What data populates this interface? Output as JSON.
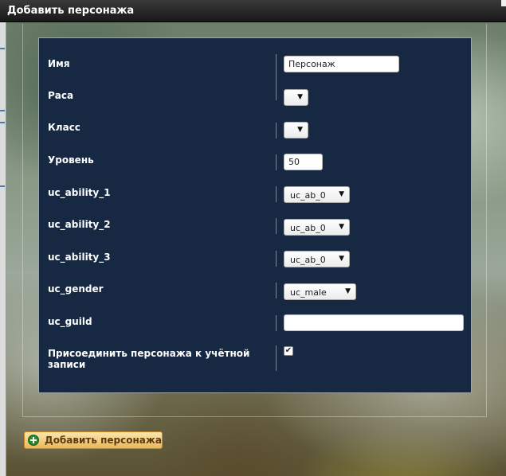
{
  "window": {
    "title": "Добавить персонажа"
  },
  "form": {
    "fields": [
      {
        "label": "Имя",
        "value": "Персонаж"
      },
      {
        "label": "Раса",
        "value": ""
      },
      {
        "label": "Класс",
        "value": ""
      },
      {
        "label": "Уровень",
        "value": "50"
      },
      {
        "label": "uc_ability_1",
        "value": "uc_ab_0"
      },
      {
        "label": "uc_ability_2",
        "value": "uc_ab_0"
      },
      {
        "label": "uc_ability_3",
        "value": "uc_ab_0"
      },
      {
        "label": "uc_gender",
        "value": "uc_male"
      },
      {
        "label": "uc_guild",
        "value": ""
      },
      {
        "label": "Присоединить персонажа к учётной записи",
        "checked": true
      }
    ]
  },
  "footer": {
    "add_button_label": "Добавить персонажа"
  },
  "icons": {
    "add": "plus-circle-icon",
    "dropdown": "caret-down-icon",
    "check": "checkmark-icon"
  },
  "colors": {
    "panel_bg": "#162842",
    "button_bg": "#eab85a",
    "title_bg": "#181818"
  }
}
